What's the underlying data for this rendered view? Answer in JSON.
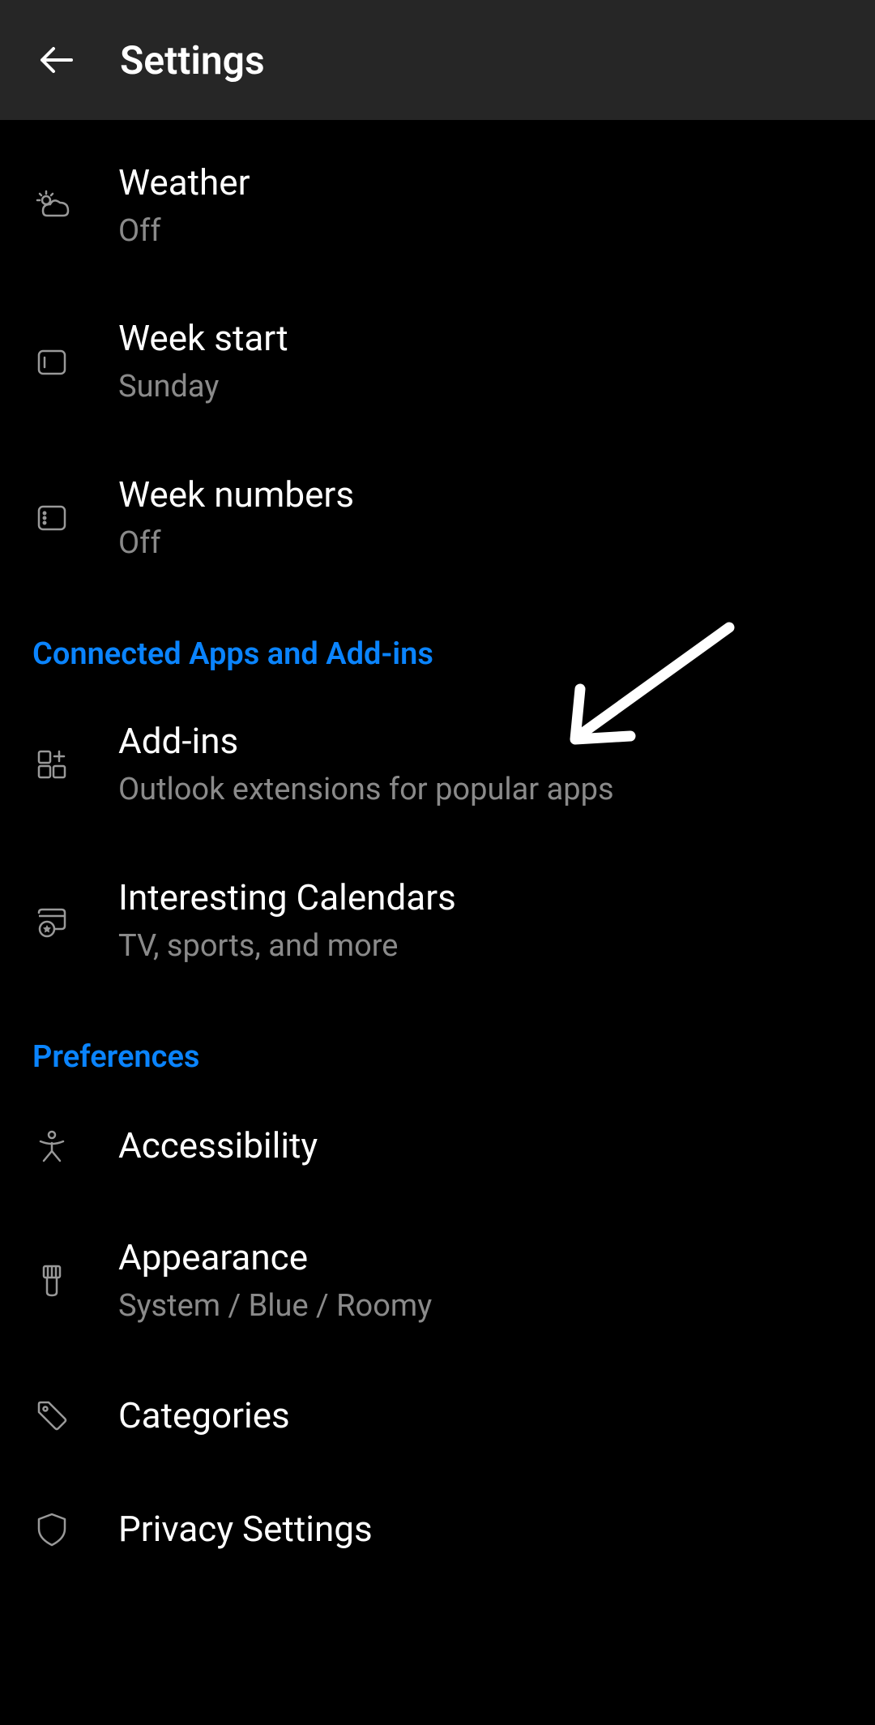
{
  "header": {
    "title": "Settings"
  },
  "items": {
    "weather": {
      "title": "Weather",
      "subtitle": "Off"
    },
    "week_start": {
      "title": "Week start",
      "subtitle": "Sunday"
    },
    "week_numbers": {
      "title": "Week numbers",
      "subtitle": "Off"
    }
  },
  "sections": {
    "connected": "Connected Apps and Add-ins",
    "preferences": "Preferences"
  },
  "connected_items": {
    "addins": {
      "title": "Add-ins",
      "subtitle": "Outlook extensions for popular apps"
    },
    "interesting": {
      "title": "Interesting Calendars",
      "subtitle": "TV, sports, and more"
    }
  },
  "preferences_items": {
    "accessibility": {
      "title": "Accessibility"
    },
    "appearance": {
      "title": "Appearance",
      "subtitle": "System / Blue / Roomy"
    },
    "categories": {
      "title": "Categories"
    },
    "privacy": {
      "title": "Privacy Settings"
    }
  }
}
